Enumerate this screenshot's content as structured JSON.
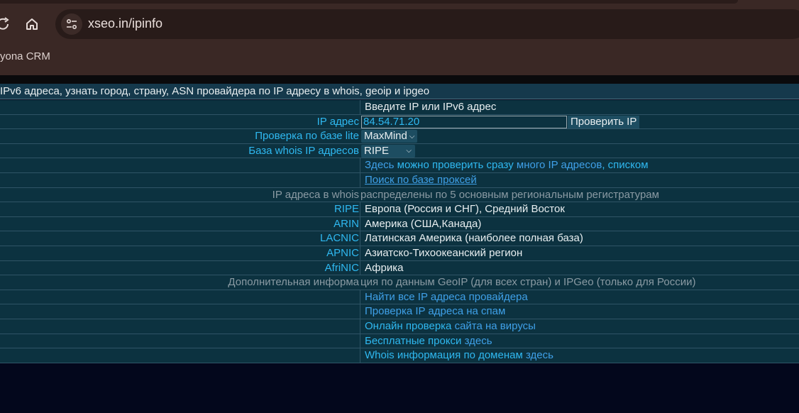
{
  "browser": {
    "url": "xseo.in/ipinfo",
    "bookmark": "yona CRM"
  },
  "page": {
    "title": "IPv6 адреса, узнать город, страну, ASN провайдера по IP адресу в whois, geoip и ipgeo",
    "prompt": "Введите IP или IPv6 адрес",
    "ip_label": "IP адрес",
    "ip_value": "84.54.71.20",
    "check_button": "Проверить IP",
    "lite_label": "Проверка по базе lite",
    "lite_value": "MaxMind",
    "whois_label": "База whois IP адресов",
    "whois_value": "RIPE",
    "multi": {
      "a": "Здесь",
      "b": "можно проверить сразу",
      "c": "много IP адресов",
      "d": ",",
      "e": "списком"
    },
    "proxy_search": "Поиск по базе проксей",
    "registries_header": {
      "a": "IP адреса в whois",
      "b": " распределены по 5 основным региональным регистратурам"
    },
    "registries": [
      {
        "name": "RIPE",
        "desc": "Европа (Россия и СНГ), Средний Восток"
      },
      {
        "name": "ARIN",
        "desc": "Америка (США,Канада)"
      },
      {
        "name": "LACNIC",
        "desc": "Латинская Америка (наиболее полная база)"
      },
      {
        "name": "APNIC",
        "desc": "Азиатско-Тихоокеанский регион"
      },
      {
        "name": "AfriNIC",
        "desc": "Африка"
      }
    ],
    "extra_header": {
      "a": "Дополнительная информа",
      "b": "ция по данным GeoIP (для всех стран) и IPGeo (только для России)"
    },
    "links": {
      "find_all": "Найти все IP адреса провайдера",
      "spam": "Проверка IP адреса на спам",
      "virus_a": "Онлайн проверка",
      "virus_b": " сайта на вирусы",
      "proxy_a": "Бесплатные прокси",
      "proxy_b": " здесь",
      "whois_a": "Whois информация по доменам",
      "whois_b": " здесь"
    }
  }
}
